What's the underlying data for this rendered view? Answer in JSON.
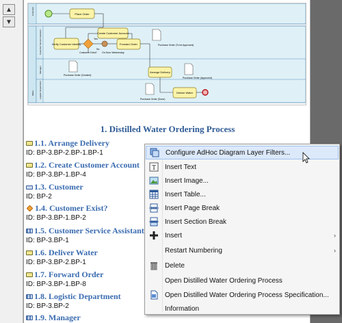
{
  "diagram": {
    "lanes": [
      "Customer",
      "Customer Service Assistant",
      "Manager",
      "Logistic Department",
      "Water"
    ],
    "nodes": {
      "place_order": "Place Order",
      "verify": "Verify Customer Identify",
      "customer_exist": "Customer Exist?",
      "create_account": "Create Customer Account",
      "forward_order": "Forward Order",
      "arrange_delivery": "Arrange Delivery",
      "deliver_water": "Deliver Water",
      "po_created": "Purchase Order (Created)",
      "po_wait": "Purchase Order (To be Approved)",
      "po_approved": "Purchase Order (Approved)",
      "po_done": "Purchase Order (Done)",
      "yes": "Yes",
      "no": "No",
      "on_hour": "On Hour Wednesday"
    }
  },
  "section_title": "1. Distilled Water Ordering Process",
  "entries": [
    {
      "title": "1.1. Arrange Delivery",
      "id": "ID: BP-3.BP-2.BP-1.BP-1",
      "icon": "task-icon"
    },
    {
      "title": "1.2. Create Customer Account",
      "id": "ID: BP-3.BP-1.BP-4",
      "icon": "task-icon"
    },
    {
      "title": "1.3. Customer",
      "id": "ID: BP-2",
      "icon": "pool-icon"
    },
    {
      "title": "1.4. Customer Exist?",
      "id": "ID: BP-3.BP-1.BP-2",
      "icon": "gateway-icon"
    },
    {
      "title": "1.5. Customer Service Assistant",
      "id": "ID: BP-3.BP-1",
      "icon": "lane-icon"
    },
    {
      "title": "1.6. Deliver Water",
      "id": "ID: BP-3.BP-2.BP-1",
      "icon": "task-icon"
    },
    {
      "title": "1.7. Forward Order",
      "id": "ID: BP-3.BP-1.BP-8",
      "icon": "task-icon"
    },
    {
      "title": "1.8. Logistic Department",
      "id": "ID: BP-3.BP-2",
      "icon": "lane-icon"
    },
    {
      "title": "1.9. Manager",
      "id": "",
      "icon": "lane-icon"
    }
  ],
  "menu": {
    "items": [
      {
        "label": "Configure AdHoc Diagram Layer Filters...",
        "icon": "layer-filter-icon",
        "submenu": false,
        "highlighted": true
      },
      {
        "label": "Insert Text",
        "icon": "text-icon",
        "submenu": false
      },
      {
        "label": "Insert Image...",
        "icon": "image-icon",
        "submenu": false
      },
      {
        "label": "Insert Table...",
        "icon": "table-icon",
        "submenu": false
      },
      {
        "label": "Insert Page Break",
        "icon": "page-break-icon",
        "submenu": false
      },
      {
        "label": "Insert Section Break",
        "icon": "section-break-icon",
        "submenu": false
      },
      {
        "label": "Insert",
        "icon": "plus-icon",
        "submenu": true
      },
      {
        "label": "Restart Numbering",
        "icon": "",
        "submenu": true
      },
      {
        "label": "Delete",
        "icon": "trash-icon",
        "submenu": false
      },
      {
        "label": "Open Distilled Water Ordering Process",
        "icon": "",
        "submenu": false
      },
      {
        "label": "Open Distilled Water Ordering Process Specification...",
        "icon": "document-icon",
        "submenu": false
      },
      {
        "label": "Information",
        "icon": "",
        "submenu": false
      }
    ],
    "submenu_arrow": "›"
  },
  "nav": {
    "up": "▲",
    "down": "▼"
  }
}
